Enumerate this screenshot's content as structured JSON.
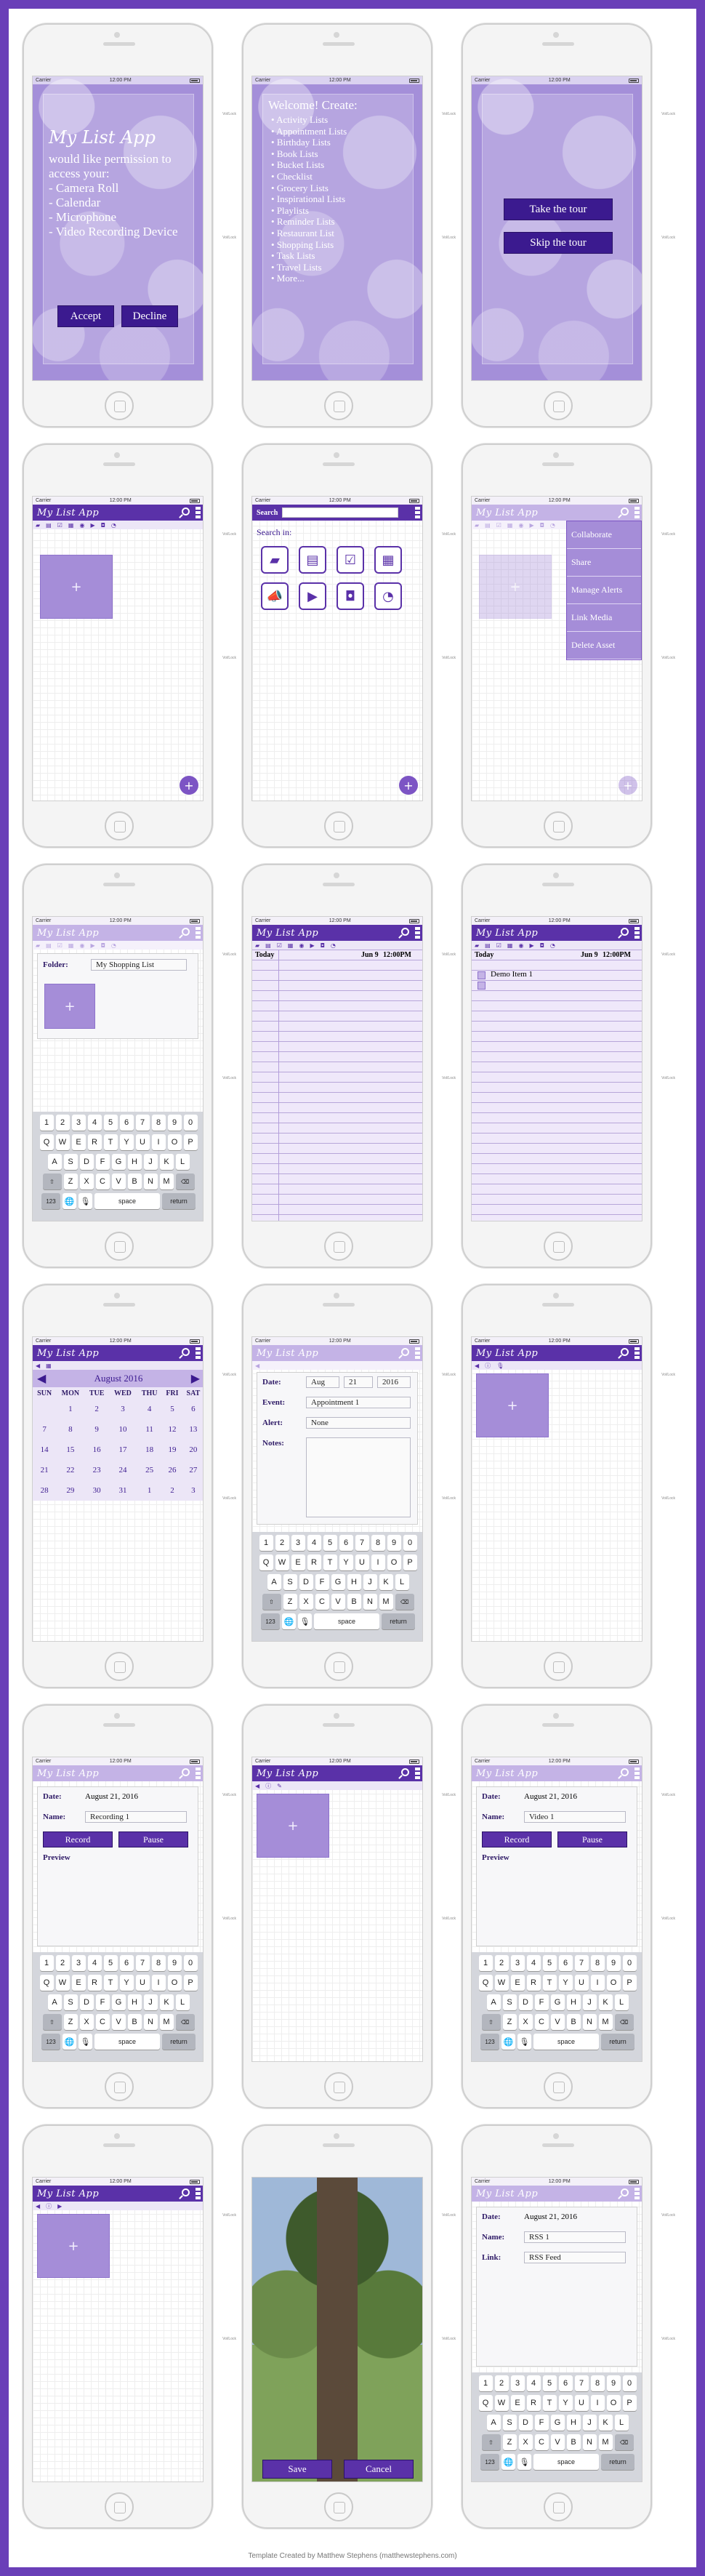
{
  "status": {
    "carrier": "Carrier",
    "time": "12:00 PM"
  },
  "side_label": "Vol/Lock",
  "app_title": "My List App",
  "permission": {
    "title": "My List App",
    "intro": "would like permission to access your:",
    "items": [
      "- Camera Roll",
      "- Calendar",
      "- Microphone",
      "- Video Recording Device"
    ],
    "accept": "Accept",
    "decline": "Decline"
  },
  "welcome": {
    "title": "Welcome! Create:",
    "items": [
      "Activity Lists",
      "Appointment Lists",
      "Birthday Lists",
      "Book Lists",
      "Bucket Lists",
      "Checklist",
      "Grocery Lists",
      "Inspirational Lists",
      "Playlists",
      "Reminder Lists",
      "Restaurant List",
      "Shopping Lists",
      "Task Lists",
      "Travel Lists",
      "More..."
    ]
  },
  "tour": {
    "take": "Take the tour",
    "skip": "Skip the tour"
  },
  "search": {
    "label": "Search",
    "search_in": "Search in:"
  },
  "context_menu": [
    "Collaborate",
    "Share",
    "Manage Alerts",
    "Link Media",
    "Delete Asset"
  ],
  "folder": {
    "label": "Folder:",
    "value": "My Shopping List"
  },
  "list": {
    "today": "Today",
    "date": "Jun 9",
    "time": "12:00PM",
    "item": "Demo Item 1"
  },
  "calendar": {
    "month": "August 2016",
    "days": [
      "SUN",
      "MON",
      "TUE",
      "WED",
      "THU",
      "FRI",
      "SAT"
    ],
    "weeks": [
      [
        "",
        "1",
        "2",
        "3",
        "4",
        "5",
        "6"
      ],
      [
        "7",
        "8",
        "9",
        "10",
        "11",
        "12",
        "13"
      ],
      [
        "14",
        "15",
        "16",
        "17",
        "18",
        "19",
        "20"
      ],
      [
        "21",
        "22",
        "23",
        "24",
        "25",
        "26",
        "27"
      ],
      [
        "28",
        "29",
        "30",
        "31",
        "1",
        "2",
        "3"
      ]
    ]
  },
  "appointment": {
    "date_label": "Date:",
    "month": "Aug",
    "day": "21",
    "year": "2016",
    "event_label": "Event:",
    "event": "Appointment 1",
    "alert_label": "Alert:",
    "alert": "None",
    "notes_label": "Notes:"
  },
  "recording": {
    "date_label": "Date:",
    "date": "August 21, 2016",
    "name_label": "Name:",
    "name": "Recording 1",
    "record": "Record",
    "pause": "Pause",
    "preview": "Preview"
  },
  "video": {
    "date_label": "Date:",
    "date": "August 21, 2016",
    "name_label": "Name:",
    "name": "Video 1",
    "record": "Record",
    "pause": "Pause",
    "preview": "Preview"
  },
  "photo": {
    "save": "Save",
    "cancel": "Cancel"
  },
  "rss": {
    "date_label": "Date:",
    "date": "August 21, 2016",
    "name_label": "Name:",
    "name": "RSS 1",
    "link_label": "Link:",
    "link": "RSS Feed"
  },
  "keyboard": {
    "row1": [
      "1",
      "2",
      "3",
      "4",
      "5",
      "6",
      "7",
      "8",
      "9",
      "0"
    ],
    "row2": [
      "Q",
      "W",
      "E",
      "R",
      "T",
      "Y",
      "U",
      "I",
      "O",
      "P"
    ],
    "row3": [
      "A",
      "S",
      "D",
      "F",
      "G",
      "H",
      "J",
      "K",
      "L"
    ],
    "row4": [
      "Z",
      "X",
      "C",
      "V",
      "B",
      "N",
      "M"
    ],
    "num": "123",
    "space": "space",
    "return": "return"
  },
  "footer": "Template Created by Matthew Stephens (matthewstephens.com)"
}
